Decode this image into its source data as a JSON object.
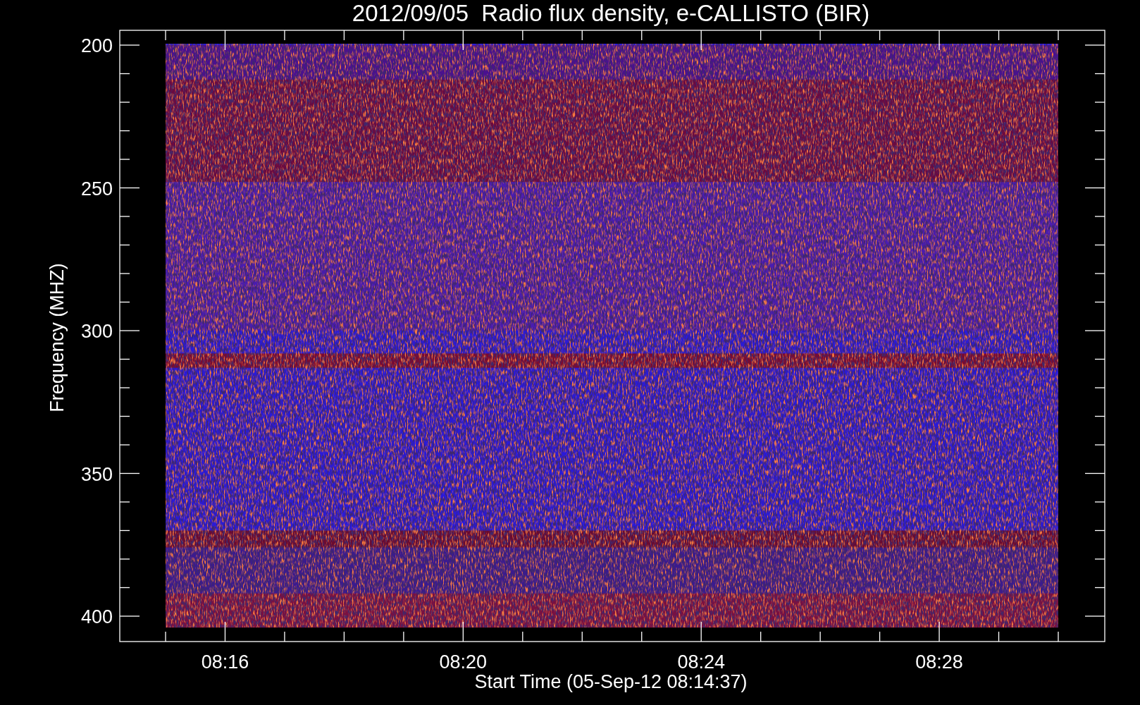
{
  "plot": {
    "title": "2012/09/05  Radio flux density, e-CALLISTO (BIR)",
    "y_axis_label": "Frequency (MHZ)",
    "x_axis_label": "Start Time (05-Sep-12 08:14:37)",
    "y_tick_labels": [
      "200",
      "250",
      "300",
      "350",
      "400"
    ],
    "x_tick_labels": [
      "08:16",
      "08:20",
      "08:24",
      "08:28"
    ]
  }
}
